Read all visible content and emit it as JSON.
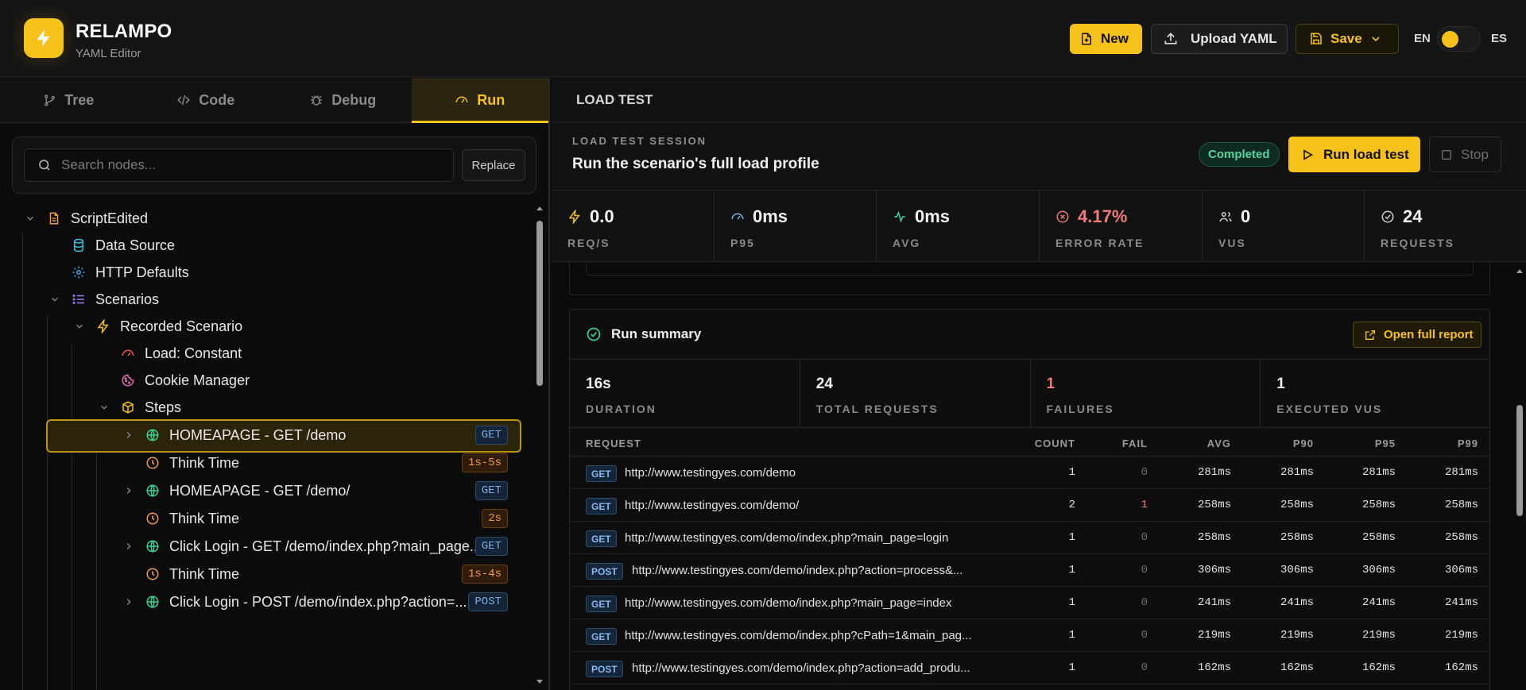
{
  "app": {
    "name": "RELAMPO",
    "subtitle": "YAML Editor"
  },
  "header": {
    "new_label": "New",
    "upload_label": "Upload YAML",
    "save_label": "Save",
    "lang_en": "EN",
    "lang_es": "ES"
  },
  "tabs": [
    {
      "label": "Tree"
    },
    {
      "label": "Code"
    },
    {
      "label": "Debug"
    },
    {
      "label": "Run"
    }
  ],
  "search": {
    "placeholder": "Search nodes...",
    "replace_label": "Replace"
  },
  "tree": [
    {
      "label": "ScriptEdited",
      "icon": "file-icon",
      "color": "#f29b45"
    },
    {
      "label": "Data Source",
      "icon": "database-icon",
      "color": "#36c5e0"
    },
    {
      "label": "HTTP Defaults",
      "icon": "gear-icon",
      "color": "#36a7f0"
    },
    {
      "label": "Scenarios",
      "icon": "list-icon",
      "color": "#9b7cf0"
    },
    {
      "label": "Recorded Scenario",
      "icon": "bolt-icon",
      "color": "#f6c21a"
    },
    {
      "label": "Load: Constant",
      "icon": "gauge-icon",
      "color": "#ef4a4a"
    },
    {
      "label": "Cookie Manager",
      "icon": "cookie-icon",
      "color": "#e06fb0"
    },
    {
      "label": "Steps",
      "icon": "box-icon",
      "color": "#f6c21a"
    },
    {
      "label": "HOMEAPAGE - GET /demo",
      "icon": "globe-icon",
      "color": "#3ad39b",
      "badge": "GET"
    },
    {
      "label": "Think Time",
      "icon": "clock-icon",
      "color": "#f29b45",
      "badge": "1s-5s"
    },
    {
      "label": "HOMEAPAGE - GET /demo/",
      "icon": "globe-icon",
      "color": "#3ad39b",
      "badge": "GET"
    },
    {
      "label": "Think Time",
      "icon": "clock-icon",
      "color": "#f29b45",
      "badge": "2s"
    },
    {
      "label": "Click Login - GET /demo/index.php?main_page...",
      "icon": "globe-icon",
      "color": "#3ad39b",
      "badge": "GET"
    },
    {
      "label": "Think Time",
      "icon": "clock-icon",
      "color": "#f29b45",
      "badge": "1s-4s"
    },
    {
      "label": "Click Login - POST /demo/index.php?action=...",
      "icon": "globe-icon",
      "color": "#3ad39b",
      "badge": "POST"
    }
  ],
  "right": {
    "panel_title": "LOAD TEST",
    "session_eyebrow": "LOAD TEST SESSION",
    "session_title": "Run the scenario's full load profile",
    "status": "Completed",
    "run_label": "Run load test",
    "stop_label": "Stop"
  },
  "metrics": [
    {
      "value": "0.0",
      "label": "REQ/S",
      "icon": "bolt-icon",
      "color": "#f6c21a"
    },
    {
      "value": "0ms",
      "label": "P95",
      "icon": "gauge-icon",
      "color": "#77aee6"
    },
    {
      "value": "0ms",
      "label": "AVG",
      "icon": "activity-icon",
      "color": "#3ad39b"
    },
    {
      "value": "4.17%",
      "label": "ERROR RATE",
      "icon": "x-circle-icon",
      "color": "#f07a7a"
    },
    {
      "value": "0",
      "label": "VUS",
      "icon": "users-icon",
      "color": "#cfcfcf"
    },
    {
      "value": "24",
      "label": "REQUESTS",
      "icon": "check-circle-icon",
      "color": "#cfcfcf"
    }
  ],
  "summary": {
    "title": "Run summary",
    "report_label": "Open full report",
    "stats": [
      {
        "value": "16s",
        "label": "DURATION"
      },
      {
        "value": "24",
        "label": "TOTAL REQUESTS"
      },
      {
        "value": "1",
        "label": "FAILURES"
      },
      {
        "value": "1",
        "label": "EXECUTED VUS"
      }
    ],
    "columns": [
      "REQUEST",
      "COUNT",
      "FAIL",
      "AVG",
      "P90",
      "P95",
      "P99"
    ],
    "rows": [
      {
        "method": "GET",
        "url": "http://www.testingyes.com/demo",
        "count": "1",
        "fail": "0",
        "avg": "281ms",
        "p90": "281ms",
        "p95": "281ms",
        "p99": "281ms"
      },
      {
        "method": "GET",
        "url": "http://www.testingyes.com/demo/",
        "count": "2",
        "fail": "1",
        "avg": "258ms",
        "p90": "258ms",
        "p95": "258ms",
        "p99": "258ms"
      },
      {
        "method": "GET",
        "url": "http://www.testingyes.com/demo/index.php?main_page=login",
        "count": "1",
        "fail": "0",
        "avg": "258ms",
        "p90": "258ms",
        "p95": "258ms",
        "p99": "258ms"
      },
      {
        "method": "POST",
        "url": "http://www.testingyes.com/demo/index.php?action=process&...",
        "count": "1",
        "fail": "0",
        "avg": "306ms",
        "p90": "306ms",
        "p95": "306ms",
        "p99": "306ms"
      },
      {
        "method": "GET",
        "url": "http://www.testingyes.com/demo/index.php?main_page=index",
        "count": "1",
        "fail": "0",
        "avg": "241ms",
        "p90": "241ms",
        "p95": "241ms",
        "p99": "241ms"
      },
      {
        "method": "GET",
        "url": "http://www.testingyes.com/demo/index.php?cPath=1&main_pag...",
        "count": "1",
        "fail": "0",
        "avg": "219ms",
        "p90": "219ms",
        "p95": "219ms",
        "p99": "219ms"
      },
      {
        "method": "POST",
        "url": "http://www.testingyes.com/demo/index.php?action=add_produ...",
        "count": "1",
        "fail": "0",
        "avg": "162ms",
        "p90": "162ms",
        "p95": "162ms",
        "p99": "162ms"
      }
    ]
  }
}
